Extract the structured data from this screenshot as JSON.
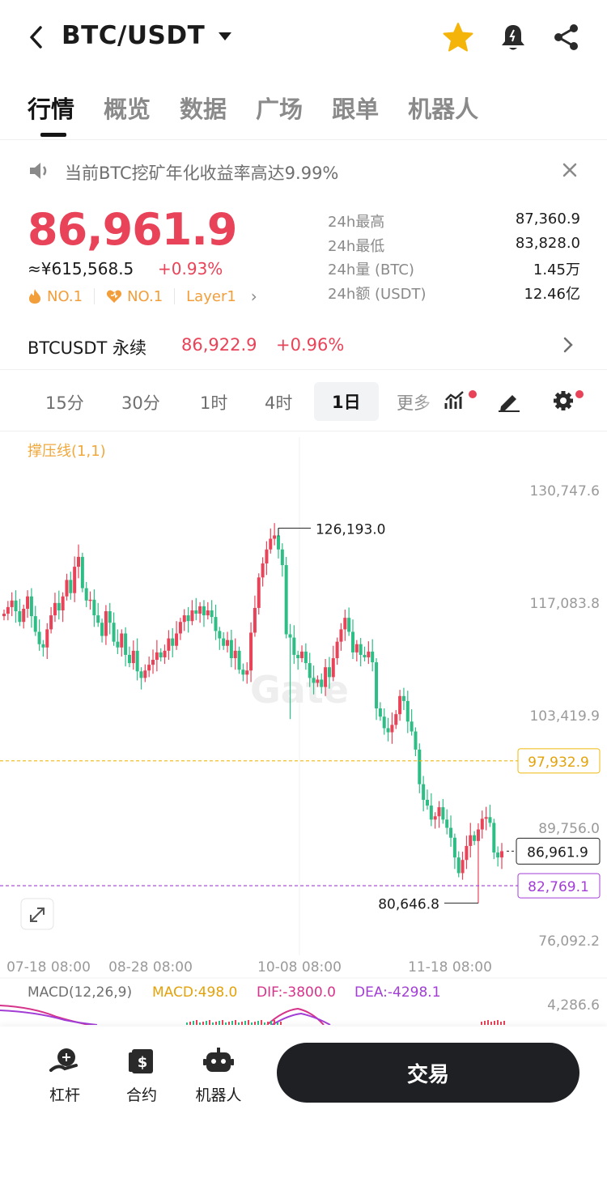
{
  "header": {
    "title": "BTC/USDT",
    "icons": [
      "back-icon",
      "caret-down-icon",
      "star-icon",
      "bell-icon",
      "share-icon"
    ]
  },
  "tabs": [
    {
      "label": "行情",
      "active": true
    },
    {
      "label": "概览"
    },
    {
      "label": "数据"
    },
    {
      "label": "广场"
    },
    {
      "label": "跟单"
    },
    {
      "label": "机器人"
    }
  ],
  "notice": {
    "text": "当前BTC挖矿年化收益率高达9.99%"
  },
  "ticker": {
    "price": "86,961.9",
    "cny": "≈¥615,568.5",
    "change": "+0.93%",
    "tags": [
      "NO.1",
      "NO.1",
      "Layer1"
    ],
    "stats": [
      {
        "label": "24h最高",
        "value": "87,360.9"
      },
      {
        "label": "24h最低",
        "value": "83,828.0"
      },
      {
        "label": "24h量 (BTC)",
        "value": "1.45万"
      },
      {
        "label": "24h额 (USDT)",
        "value": "12.46亿"
      }
    ]
  },
  "perpetual": {
    "name": "BTCUSDT 永续",
    "price": "86,922.9",
    "change": "+0.96%"
  },
  "timeframes": {
    "items": [
      "15分",
      "30分",
      "1时",
      "4时",
      "1日"
    ],
    "active": "1日",
    "more": "更多"
  },
  "chart": {
    "indicator": "撑压线(1,1)",
    "watermark": "Gate",
    "price_axis": [
      "130,747.6",
      "117,083.8",
      "103,419.9",
      "89,756.0",
      "76,092.2"
    ],
    "time_axis": [
      "07-18 08:00",
      "08-28 08:00",
      "10-08 08:00",
      "11-18 08:00"
    ],
    "high_label": "126,193.0",
    "low_label": "80,646.8",
    "resistance": "97,932.9",
    "support": "82,769.1",
    "current": "86,961.9",
    "macd_label": "MACD(12,26,9)",
    "macd_value": "MACD:498.0",
    "dif_value": "DIF:-3800.0",
    "dea_value": "DEA:-4298.1",
    "macd_axis": "4,286.6",
    "colors": {
      "up": "#e84358",
      "down": "#2ebd85",
      "resistance": "#f0b90b",
      "support": "#a23dd6"
    }
  },
  "chart_data": {
    "type": "candlestick",
    "title": "BTC/USDT 1日",
    "ylim": [
      74000,
      132000
    ],
    "yticks": [
      130747.6,
      117083.8,
      103419.9,
      89756.0,
      76092.2
    ],
    "xticks": [
      "07-18 08:00",
      "08-28 08:00",
      "10-08 08:00",
      "11-18 08:00"
    ],
    "annotations": {
      "high": 126193.0,
      "low": 80646.8,
      "resistance": 97932.9,
      "support": 82769.1,
      "last": 86961.9
    }
  },
  "bottom": {
    "items": [
      {
        "label": "杠杆"
      },
      {
        "label": "合约"
      },
      {
        "label": "机器人"
      }
    ],
    "trade": "交易"
  }
}
